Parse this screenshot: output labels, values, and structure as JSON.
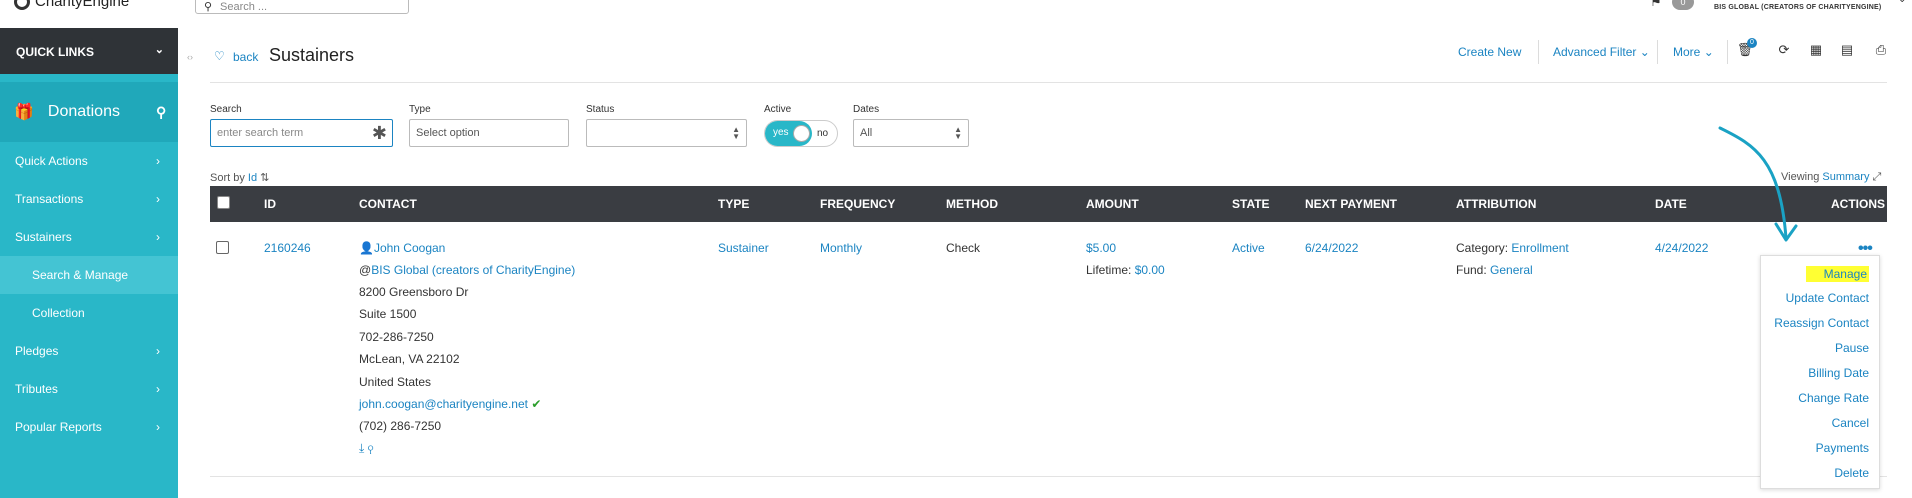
{
  "topbar": {
    "brand": "CharityEngine",
    "search_placeholder": "Search ...",
    "notification_count": "0",
    "org_name": "BIS GLOBAL (CREATORS OF CHARITYENGINE)"
  },
  "sidebar": {
    "quick_links": "QUICK LINKS",
    "section": "Donations",
    "items": [
      {
        "label": "Quick Actions"
      },
      {
        "label": "Transactions"
      },
      {
        "label": "Sustainers"
      },
      {
        "label": "Search & Manage"
      },
      {
        "label": "Collection"
      },
      {
        "label": "Pledges"
      },
      {
        "label": "Tributes"
      },
      {
        "label": "Popular Reports"
      }
    ]
  },
  "header": {
    "back": "back",
    "title": "Sustainers",
    "create_new": "Create New",
    "advanced_filter": "Advanced Filter",
    "more": "More",
    "cart_badge": "0"
  },
  "filters": {
    "search_label": "Search",
    "search_placeholder": "enter search term",
    "type_label": "Type",
    "type_value": "Select option",
    "status_label": "Status",
    "status_value": "",
    "active_label": "Active",
    "active_yes": "yes",
    "active_no": "no",
    "dates_label": "Dates",
    "dates_value": "All"
  },
  "sort": {
    "prefix": "Sort by",
    "field": "Id"
  },
  "viewing": {
    "prefix": "Viewing",
    "mode": "Summary"
  },
  "table": {
    "columns": [
      "ID",
      "CONTACT",
      "TYPE",
      "FREQUENCY",
      "METHOD",
      "AMOUNT",
      "STATE",
      "NEXT PAYMENT",
      "ATTRIBUTION",
      "DATE",
      "ACTIONS"
    ],
    "row": {
      "id": "2160246",
      "contact_name": "John Coogan",
      "contact_org": "BIS Global (creators of CharityEngine)",
      "address1": "8200 Greensboro Dr",
      "address2": "Suite 1500",
      "phone_raw": "702-286-7250",
      "city": "McLean, VA 22102",
      "country": "United States",
      "email": "john.coogan@charityengine.net",
      "phone": "(702) 286-7250",
      "type": "Sustainer",
      "frequency": "Monthly",
      "method": "Check",
      "amount": "$5.00",
      "lifetime_label": "Lifetime:",
      "lifetime_value": "$0.00",
      "state": "Active",
      "next_payment": "6/24/2022",
      "category_label": "Category:",
      "category_value": "Enrollment",
      "fund_label": "Fund:",
      "fund_value": "General",
      "date": "4/24/2022"
    }
  },
  "actions_menu": [
    "Manage",
    "Update Contact",
    "Reassign Contact",
    "Pause",
    "Billing Date",
    "Change Rate",
    "Cancel",
    "Payments",
    "Delete"
  ],
  "colors": {
    "accent": "#29b7c8",
    "link": "#1b84c2",
    "header_dark": "#3a3d42",
    "highlight": "#ffff33"
  }
}
